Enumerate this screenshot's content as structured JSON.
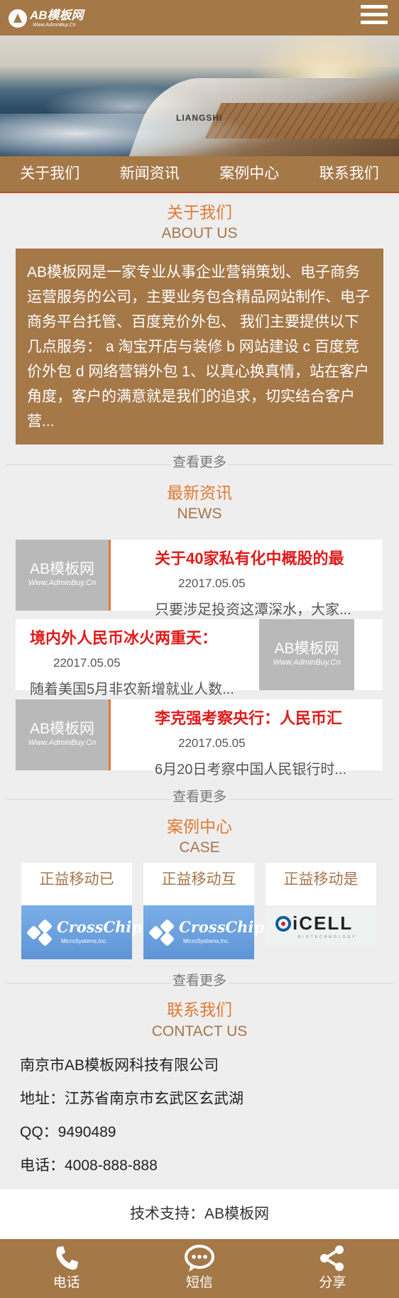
{
  "header": {
    "logo_main": "AB模板网",
    "logo_sub": "Www.AdminBuy.Cn"
  },
  "banner": {
    "caption": "LIANGSHI"
  },
  "nav": [
    {
      "label": "关于我们"
    },
    {
      "label": "新闻资讯"
    },
    {
      "label": "案例中心"
    },
    {
      "label": "联系我们"
    }
  ],
  "about": {
    "title": "关于我们",
    "subtitle": "ABOUT US",
    "body": "AB模板网是一家专业从事企业营销策划、电子商务运营服务的公司，主要业务包含精品网站制作、电子商务平台托管、百度竞价外包、 我们主要提供以下几点服务： a 淘宝开店与装修 b 网站建设 c 百度竞价外包 d 网络营销外包 1、以真心换真情，站在客户角度，客户的满意就是我们的追求，切实结合客户营..."
  },
  "more_label": "查看更多",
  "news": {
    "title": "最新资讯",
    "subtitle": "NEWS",
    "thumb_main": "AB模板网",
    "thumb_sub": "Www.AdminBuy.Cn",
    "items": [
      {
        "title": "关于40家私有化中概股的最",
        "date": "22017.05.05",
        "desc": "只要涉足投资这潭深水，大家..."
      },
      {
        "title": "境内外人民币冰火两重天：",
        "date": "22017.05.05",
        "desc": "随着美国5月非农新增就业人数..."
      },
      {
        "title": "李克强考察央行：人民币汇",
        "date": "22017.05.05",
        "desc": "6月20日考察中国人民银行时..."
      }
    ]
  },
  "cases": {
    "title": "案例中心",
    "subtitle": "CASE",
    "items": [
      {
        "title": "正益移动已",
        "logo": "CrossChip",
        "logo_sub": "MicroSystems,Inc."
      },
      {
        "title": "正益移动互",
        "logo": "CrossChip",
        "logo_sub": "MicroSystems,Inc."
      },
      {
        "title": "正益移动是",
        "logo": "iCELL",
        "logo_sub": "BIOTECHNOLOGY"
      }
    ]
  },
  "contact": {
    "title": "联系我们",
    "subtitle": "CONTACT US",
    "company": "南京市AB模板网科技有限公司",
    "address": "地址：江苏省南京市玄武区玄武湖",
    "qq": "QQ：9490489",
    "phone": "电话：4008-888-888"
  },
  "support": "技术支持：AB模板网",
  "footer": [
    {
      "label": "电话",
      "icon": "phone-icon"
    },
    {
      "label": "短信",
      "icon": "message-icon"
    },
    {
      "label": "分享",
      "icon": "share-icon"
    }
  ],
  "colors": {
    "brand_brown": "#a57848",
    "accent_orange": "#e07a34",
    "news_red": "#e01b1b"
  }
}
